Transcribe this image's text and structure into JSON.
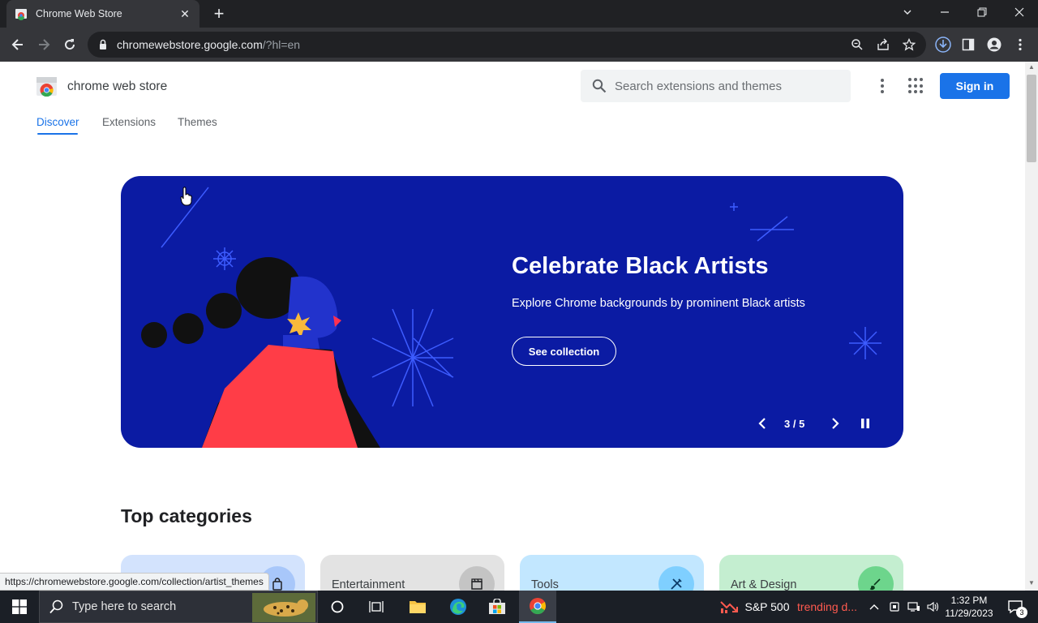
{
  "browser": {
    "tab_title": "Chrome Web Store",
    "tab_close": "✕",
    "new_tab": "+",
    "url_host": "chromewebstore.google.com",
    "url_path": "/?hl=en"
  },
  "header": {
    "brand_name": "chrome web store",
    "search_placeholder": "Search extensions and themes",
    "signin_label": "Sign in"
  },
  "nav": {
    "tabs": [
      {
        "label": "Discover",
        "active": true
      },
      {
        "label": "Extensions",
        "active": false
      },
      {
        "label": "Themes",
        "active": false
      }
    ]
  },
  "hero": {
    "title": "Celebrate Black Artists",
    "subtitle": "Explore Chrome backgrounds by prominent Black artists",
    "button_label": "See collection",
    "counter": "3 / 5"
  },
  "categories": {
    "title": "Top categories",
    "items": [
      {
        "label": "",
        "bg": "#d3e3fd",
        "icon_bg": "#a8c7fa"
      },
      {
        "label": "Entertainment",
        "bg": "#e3e3e3",
        "icon_bg": "#c4c4c4"
      },
      {
        "label": "Tools",
        "bg": "#c2e7ff",
        "icon_bg": "#7fcfff"
      },
      {
        "label": "Art & Design",
        "bg": "#c4eed0",
        "icon_bg": "#6dd58c"
      }
    ]
  },
  "status_url": "https://chromewebstore.google.com/collection/artist_themes",
  "taskbar": {
    "search_placeholder": "Type here to search",
    "ticker_name": "S&P 500",
    "ticker_status": "trending d...",
    "time": "1:32 PM",
    "date": "11/29/2023",
    "notification_count": "3"
  },
  "colors": {
    "accent": "#1a73e8",
    "hero_bg": "#0b1ba3",
    "ticker_status": "#ff5a4f"
  }
}
